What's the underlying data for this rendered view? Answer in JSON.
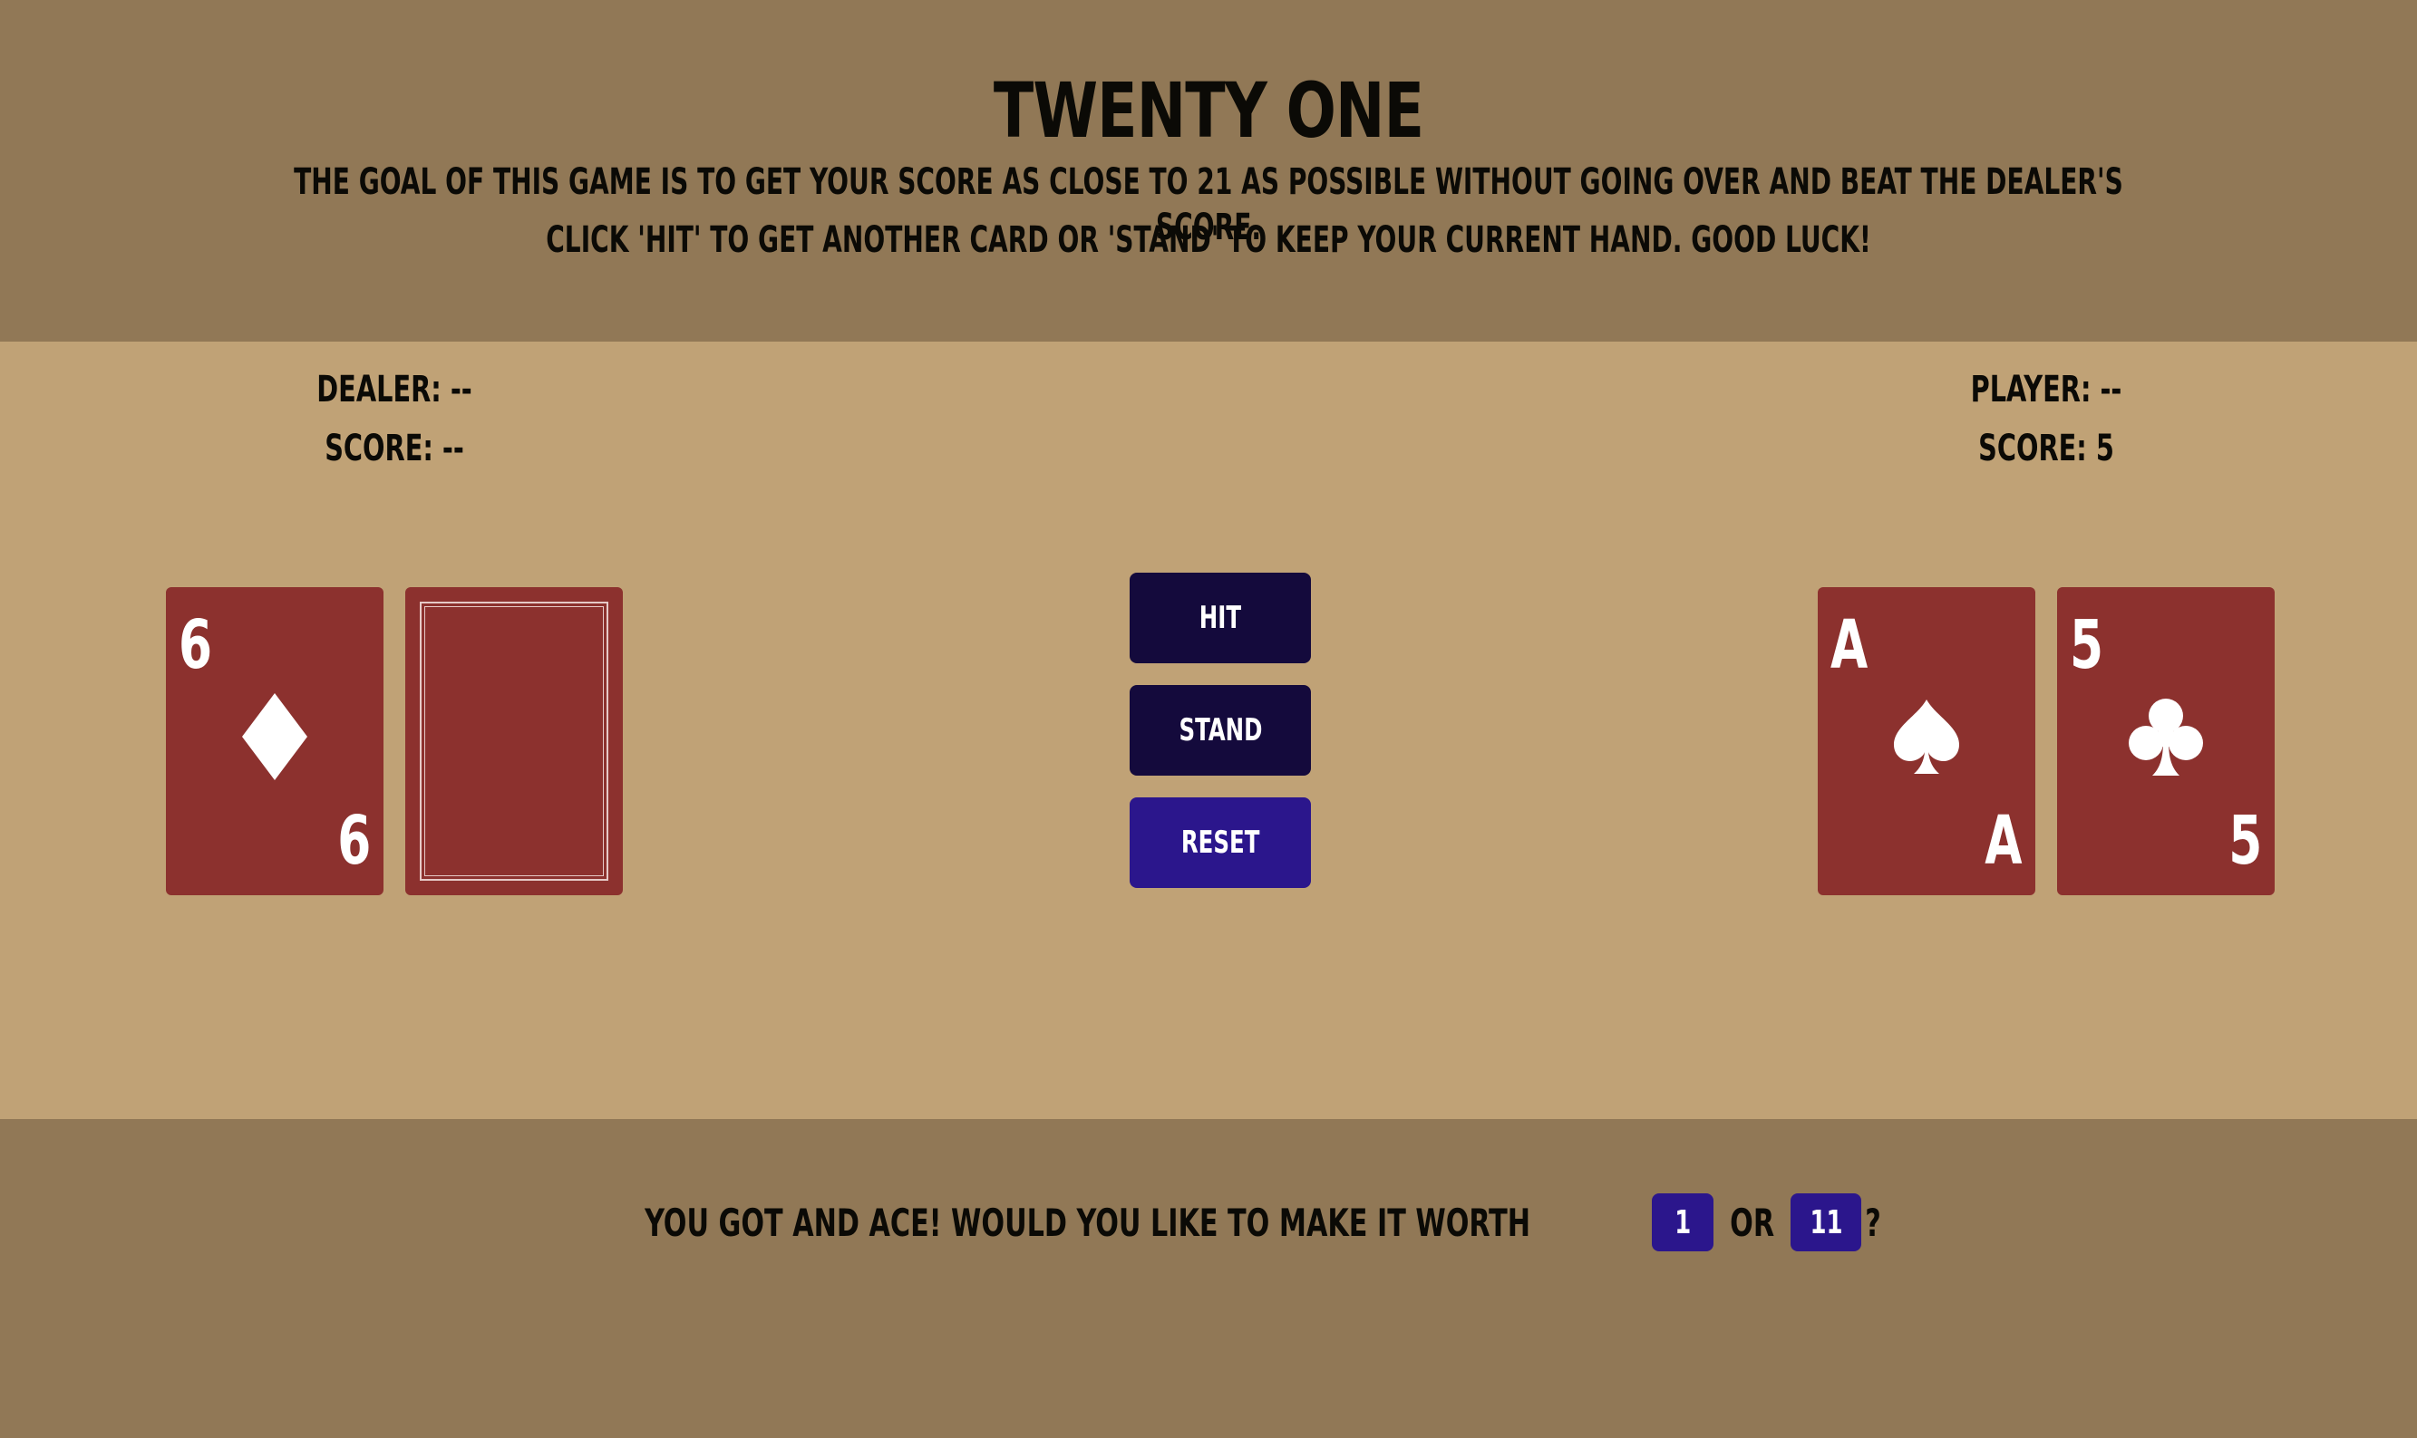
{
  "header": {
    "title": "Twenty One",
    "line1": "The goal of this game is to get your score as close to 21 as possible without going over and beat the dealer's score.",
    "line2": "Click 'hit' to get another card or 'stand' to keep your current hand. Good luck!"
  },
  "dealer": {
    "name_label": "Dealer: --",
    "score_label": "Score: --",
    "cards": [
      {
        "rank": "6",
        "suit": "diamond",
        "face_up": true
      },
      {
        "face_up": false
      }
    ]
  },
  "player": {
    "name_label": "Player: --",
    "score_label": "Score: 5",
    "cards": [
      {
        "rank": "A",
        "suit": "spade",
        "face_up": true
      },
      {
        "rank": "5",
        "suit": "club",
        "face_up": true
      }
    ]
  },
  "controls": {
    "hit_label": "Hit",
    "stand_label": "Stand",
    "reset_label": "Reset"
  },
  "ace_prompt": {
    "text": "You got and ace! Would you like to make it worth",
    "option_low": "1",
    "or_text": "or",
    "option_high": "11",
    "end_text": "?"
  },
  "colors": {
    "header_bg": "#917856",
    "table_bg": "#c0a276",
    "card_red": "#8c312e",
    "button_dark": "#140a3c",
    "button_accent": "#2b168c"
  }
}
